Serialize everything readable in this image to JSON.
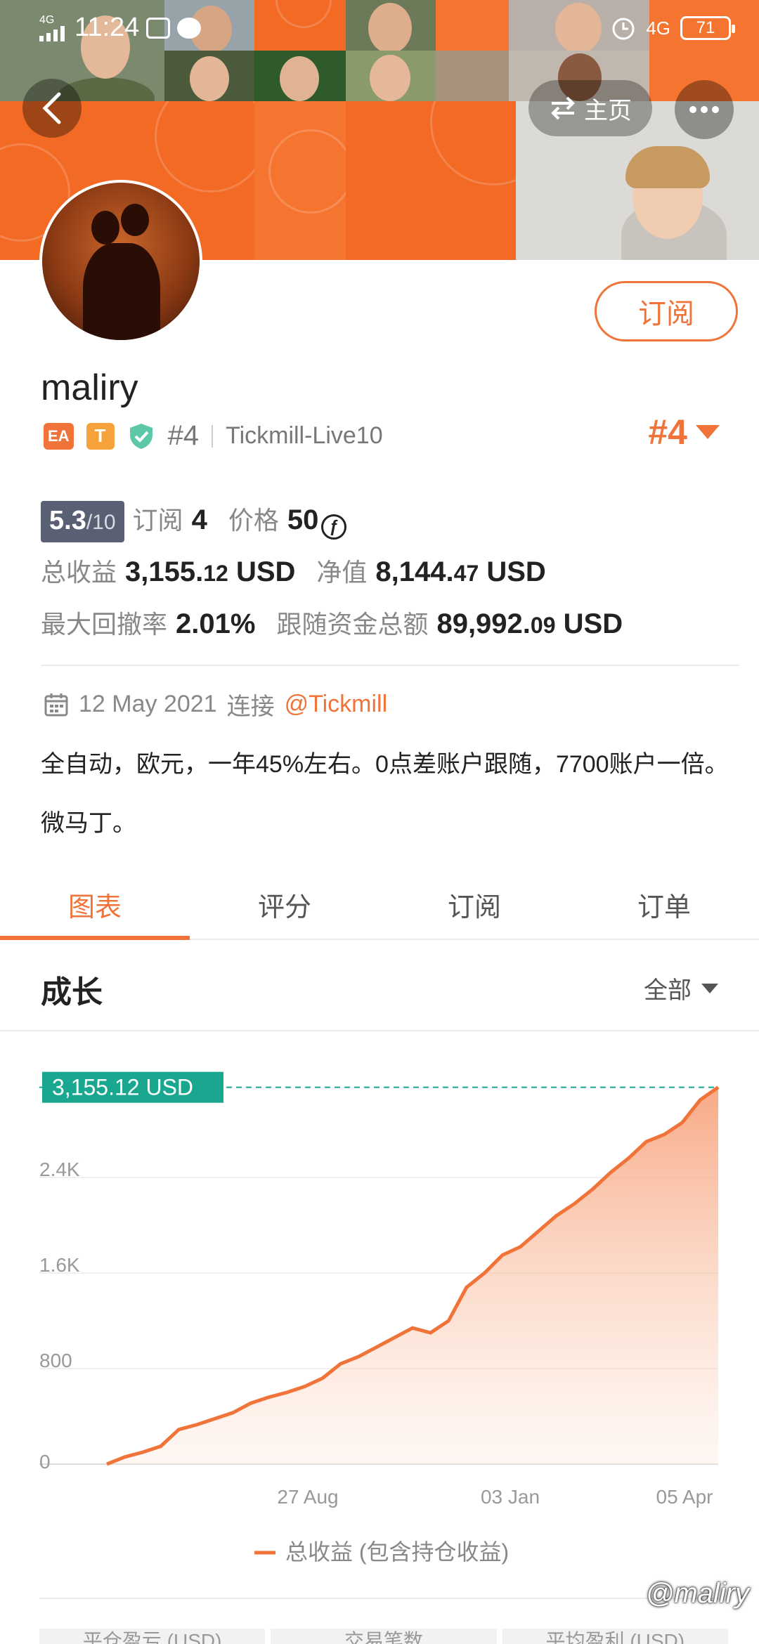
{
  "status_bar": {
    "network": "4G",
    "time": "11:24",
    "right_network": "4G",
    "battery": "71"
  },
  "header": {
    "home_label": "主页"
  },
  "profile": {
    "subscribe_label": "订阅",
    "username": "maliry",
    "badge_ea": "EA",
    "badge_t": "T",
    "rank_small": "#4",
    "broker": "Tickmill-Live10",
    "rank_big": "#4"
  },
  "stats": {
    "score_main": "5.3",
    "score_max": "/10",
    "subscribe_label": "订阅",
    "subscribe_count": "4",
    "price_label": "价格",
    "price_value": "50",
    "total_profit_label": "总收益",
    "total_profit_int": "3,155.",
    "total_profit_dec": "12",
    "total_profit_unit": "USD",
    "equity_label": "净值",
    "equity_int": "8,144.",
    "equity_dec": "47",
    "equity_unit": "USD",
    "drawdown_label": "最大回撤率",
    "drawdown_value": "2.01%",
    "follow_label": "跟随资金总额",
    "follow_int": "89,992.",
    "follow_dec": "09",
    "follow_unit": "USD"
  },
  "connection": {
    "date": "12 May 2021",
    "connect_label": "连接",
    "link": "@Tickmill"
  },
  "description": "全自动，欧元，一年45%左右。0点差账户跟随，7700账户一倍。微马丁。",
  "tabs": [
    {
      "label": "图表",
      "active": true
    },
    {
      "label": "评分",
      "active": false
    },
    {
      "label": "订阅",
      "active": false
    },
    {
      "label": "订单",
      "active": false
    }
  ],
  "growth": {
    "title": "成长",
    "filter": "全部"
  },
  "chart_data": {
    "type": "area",
    "current_label": "3,155.12 USD",
    "y_ticks": [
      "0",
      "800",
      "1.6K",
      "2.4K"
    ],
    "x_ticks": [
      "27 Aug",
      "03 Jan",
      "05 Apr"
    ],
    "ylim": [
      0,
      3200
    ],
    "legend": "总收益 (包含持仓收益)",
    "line_color": "#f0743a",
    "label_color": "#19a88f",
    "values": [
      0,
      60,
      100,
      150,
      290,
      330,
      380,
      430,
      510,
      560,
      600,
      650,
      720,
      840,
      900,
      980,
      1060,
      1140,
      1100,
      1200,
      1480,
      1600,
      1750,
      1820,
      1950,
      2080,
      2180,
      2300,
      2440,
      2560,
      2700,
      2760,
      2860,
      3050,
      3155.12
    ]
  },
  "bottom_labels": [
    "平仓盈亏 (USD)",
    "交易笔数",
    "平均盈利 (USD)"
  ],
  "watermark": "@maliry"
}
